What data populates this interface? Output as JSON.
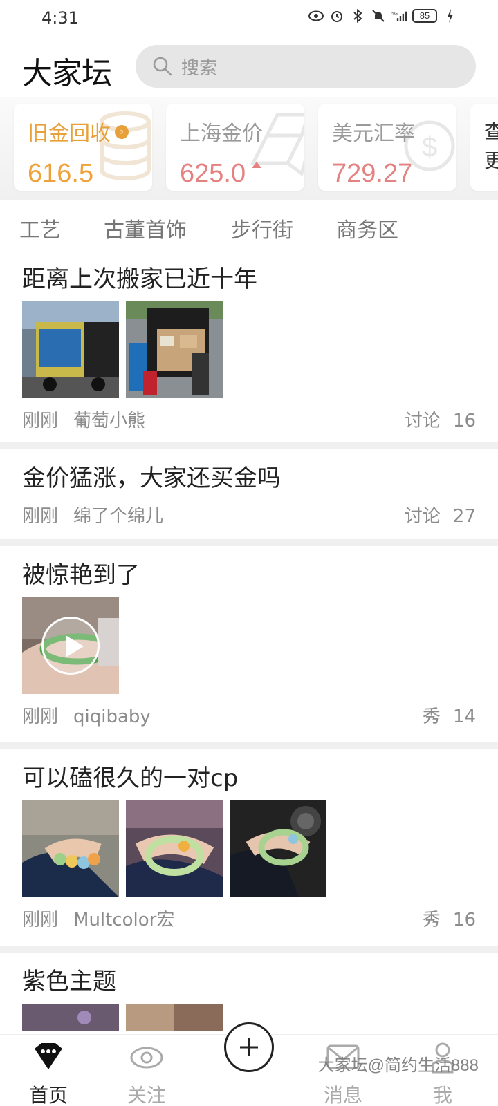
{
  "status_bar": {
    "time": "4:31",
    "battery": "85",
    "signal": "5G"
  },
  "header": {
    "logo": "大家坛",
    "search_placeholder": "搜索"
  },
  "price_cards": [
    {
      "label": "旧金回收",
      "value": "616.5"
    },
    {
      "label": "上海金价",
      "value": "625.0"
    },
    {
      "label": "美元汇率",
      "value": "729.27"
    },
    {
      "label": "查更"
    }
  ],
  "tabs": [
    "工艺",
    "古董首饰",
    "步行街",
    "商务区"
  ],
  "posts": [
    {
      "title": "距离上次搬家已近十年",
      "time": "刚刚",
      "author": "葡萄小熊",
      "category": "讨论",
      "count": "16"
    },
    {
      "title": "金价猛涨，大家还买金吗",
      "time": "刚刚",
      "author": "绵了个绵儿",
      "category": "讨论",
      "count": "27"
    },
    {
      "title": "被惊艳到了",
      "time": "刚刚",
      "author": "qiqibaby",
      "category": "秀",
      "count": "14"
    },
    {
      "title": "可以磕很久的一对cp",
      "time": "刚刚",
      "author": "Multcolor宏",
      "category": "秀",
      "count": "16"
    },
    {
      "title": "紫色主题"
    }
  ],
  "bottom_nav": {
    "home": "首页",
    "follow": "关注",
    "messages": "消息",
    "me": "我",
    "watermark": "大家坛@简约生活888"
  },
  "colors": {
    "gold": "#f0a23a",
    "rose": "#e48181",
    "muted": "#8c8c8c"
  }
}
